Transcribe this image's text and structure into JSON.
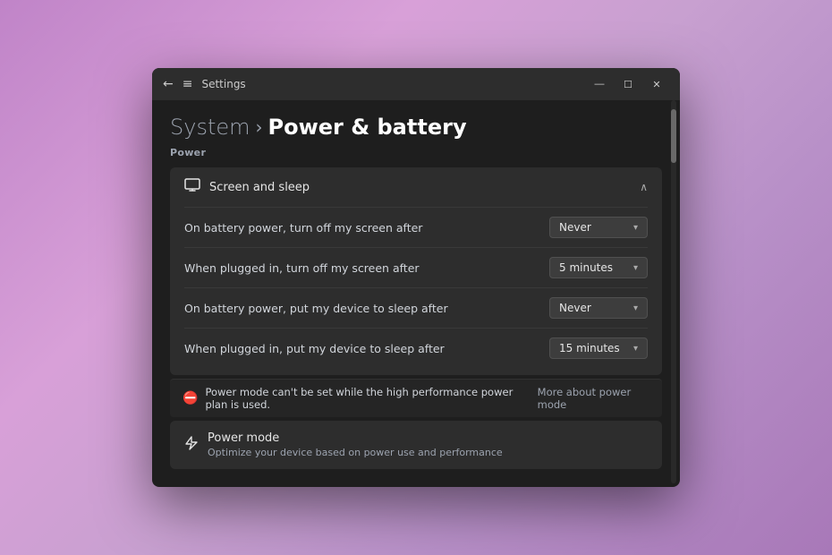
{
  "window": {
    "title": "Settings",
    "min_btn": "—",
    "max_btn": "☐",
    "close_btn": "✕"
  },
  "breadcrumb": {
    "system_label": "System",
    "separator": "›",
    "current_label": "Power & battery"
  },
  "section_power_label": "Power",
  "screen_sleep": {
    "header_label": "Screen and sleep",
    "rows": [
      {
        "label": "On battery power, turn off my screen after",
        "value": "Never"
      },
      {
        "label": "When plugged in, turn off my screen after",
        "value": "5 minutes"
      },
      {
        "label": "On battery power, put my device to sleep after",
        "value": "Never"
      },
      {
        "label": "When plugged in, put my device to sleep after",
        "value": "15 minutes"
      }
    ]
  },
  "warning": {
    "text": "Power mode can't be set while the high performance power plan is used.",
    "link_label": "More about power mode"
  },
  "power_mode": {
    "title": "Power mode",
    "subtitle": "Optimize your device based on power use and performance"
  },
  "icons": {
    "back": "←",
    "hamburger": "≡",
    "monitor": "⬜",
    "chevron_up": "^",
    "warning_circle": "⊘",
    "lightning": "⚡"
  }
}
